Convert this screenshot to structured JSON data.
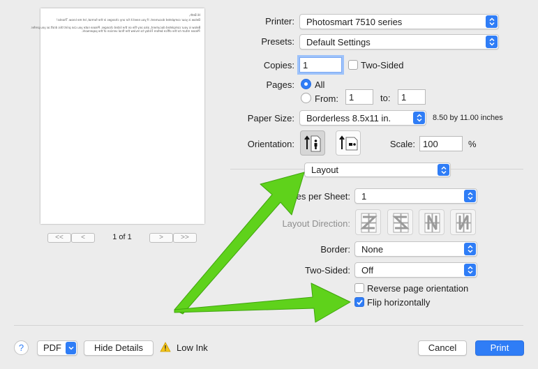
{
  "preview": {
    "page_lines": [
      "Hi Beth,",
      "Below is your completed document. If you need it for any changes in the format, let me know. Thanks!",
      "Below is your completed document, also any file on the listed changes. Please note you can print this draft as you prefer.",
      "Please return to the office before Friday to review the final version of the paperwork."
    ],
    "page_indicator": "1 of 1",
    "nav_first": "<<",
    "nav_prev": "<",
    "nav_next": ">",
    "nav_last": ">>"
  },
  "printer": {
    "label": "Printer:",
    "value": "Photosmart 7510 series"
  },
  "presets": {
    "label": "Presets:",
    "value": "Default Settings"
  },
  "copies": {
    "label": "Copies:",
    "value": "1",
    "two_sided_label": "Two-Sided",
    "two_sided_checked": false
  },
  "pages": {
    "label": "Pages:",
    "all_label": "All",
    "from_label": "From:",
    "from_value": "1",
    "to_label": "to:",
    "to_value": "1",
    "selected": "All"
  },
  "paper_size": {
    "label": "Paper Size:",
    "value": "Borderless 8.5x11 in.",
    "dimensions": "8.50 by 11.00 inches"
  },
  "orientation": {
    "label": "Orientation:",
    "selected": "portrait"
  },
  "scale": {
    "label": "Scale:",
    "value": "100",
    "unit": "%"
  },
  "section_menu": {
    "value": "Layout"
  },
  "layout": {
    "pages_per_sheet": {
      "label": "es per Sheet:",
      "value": "1"
    },
    "layout_direction": {
      "label": "Layout Direction:"
    },
    "border": {
      "label": "Border:",
      "value": "None"
    },
    "two_sided": {
      "label": "Two-Sided:",
      "value": "Off"
    },
    "reverse_orientation": {
      "label": "Reverse page orientation",
      "checked": false
    },
    "flip_horizontally": {
      "label": "Flip horizontally",
      "checked": true
    }
  },
  "footer": {
    "help_label": "?",
    "pdf_label": "PDF",
    "hide_details_label": "Hide Details",
    "warning_text": "Low Ink",
    "cancel_label": "Cancel",
    "print_label": "Print"
  },
  "colors": {
    "accent": "#2f7df6",
    "annotation_arrow": "#5fd21b",
    "background": "#ececec"
  }
}
